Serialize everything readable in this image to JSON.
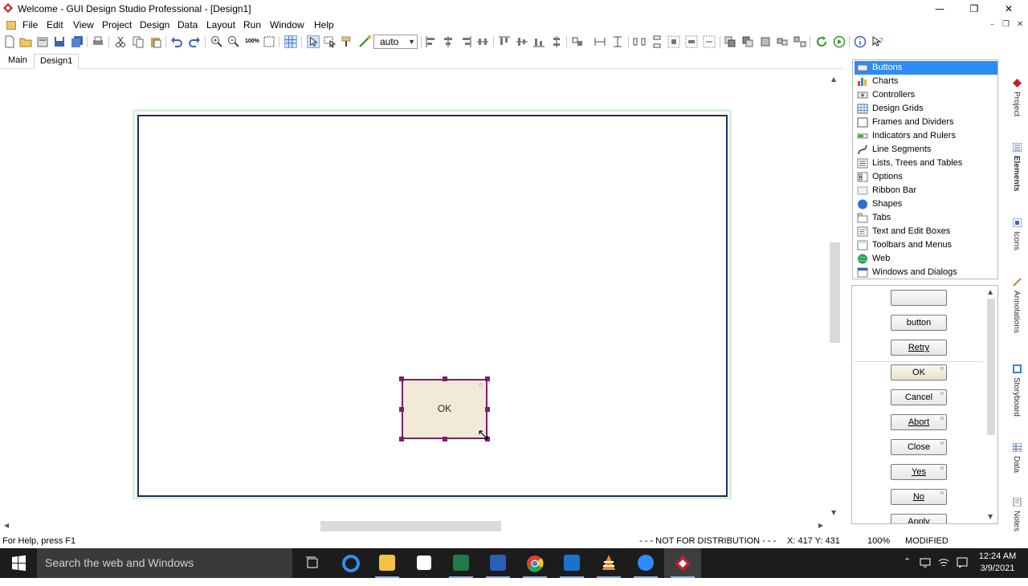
{
  "window": {
    "title": "Welcome - GUI Design Studio Professional - [Design1]",
    "minimize_glyph": "—",
    "restore_glyph": "❐",
    "close_glyph": "✕"
  },
  "menu": {
    "items": [
      "File",
      "Edit",
      "View",
      "Project",
      "Design",
      "Data",
      "Layout",
      "Run",
      "Window",
      "Help"
    ],
    "mdi_minimize": "–",
    "mdi_restore": "❐",
    "mdi_close": "✕"
  },
  "toolbar": {
    "zoom_value": "auto",
    "zoom_arrow": "▼",
    "zoom_100_label": "100%"
  },
  "tabs": {
    "main": "Main",
    "design1": "Design1"
  },
  "canvas": {
    "ok_button_label": "OK"
  },
  "categories": {
    "items": [
      {
        "label": "Buttons",
        "icon": "button-category-icon"
      },
      {
        "label": "Charts",
        "icon": "chart-category-icon"
      },
      {
        "label": "Controllers",
        "icon": "controller-category-icon"
      },
      {
        "label": "Design Grids",
        "icon": "grid-category-icon"
      },
      {
        "label": "Frames and Dividers",
        "icon": "frame-category-icon"
      },
      {
        "label": "Indicators and Rulers",
        "icon": "indicator-category-icon"
      },
      {
        "label": "Line Segments",
        "icon": "line-category-icon"
      },
      {
        "label": "Lists, Trees and Tables",
        "icon": "list-category-icon"
      },
      {
        "label": "Options",
        "icon": "options-category-icon"
      },
      {
        "label": "Ribbon Bar",
        "icon": "ribbon-category-icon"
      },
      {
        "label": "Shapes",
        "icon": "shape-category-icon"
      },
      {
        "label": "Tabs",
        "icon": "tabs-category-icon"
      },
      {
        "label": "Text and Edit Boxes",
        "icon": "text-category-icon"
      },
      {
        "label": "Toolbars and Menus",
        "icon": "toolbar-category-icon"
      },
      {
        "label": "Web",
        "icon": "web-category-icon"
      },
      {
        "label": "Windows and Dialogs",
        "icon": "window-category-icon"
      }
    ]
  },
  "elements": {
    "buttons": [
      "",
      "button",
      "Retry",
      "OK",
      "Cancel",
      "Abort",
      "Close",
      "Yes",
      "No",
      "Apply"
    ]
  },
  "side_tabs": [
    "Project",
    "Elements",
    "Icons",
    "Annotations",
    "Storyboard",
    "Data",
    "Notes"
  ],
  "status": {
    "help": "For Help, press F1",
    "distribution": "- - - NOT FOR DISTRIBUTION - - -",
    "coords": "X: 417  Y: 431",
    "zoom": "100%",
    "state": "MODIFIED"
  },
  "taskbar": {
    "search_placeholder": "Search the web and Windows",
    "time": "12:24 AM",
    "date": "3/9/2021",
    "accent": "#8ab4f8"
  }
}
